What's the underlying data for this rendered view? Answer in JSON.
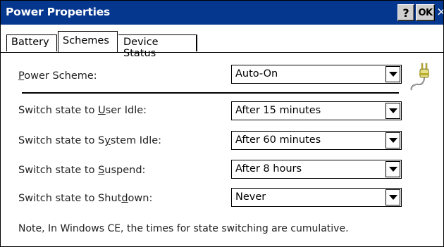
{
  "window": {
    "title": "Power Properties",
    "help_label": "?",
    "ok_label": "OK",
    "close_label": "×",
    "titlebar_color": "#06378f"
  },
  "tabs": [
    {
      "label": "Battery",
      "selected": false
    },
    {
      "label": "Schemes",
      "selected": true
    },
    {
      "label": "Device Status",
      "selected": false
    }
  ],
  "power_scheme": {
    "label_prefix": "",
    "label_mnemonic": "P",
    "label_rest": "ower Scheme:",
    "value": "Auto-On",
    "icon": "power-plug-icon"
  },
  "rows": [
    {
      "label_prefix": "Switch state to ",
      "mnemonic": "U",
      "label_rest": "ser Idle:",
      "value": "After 15 minutes"
    },
    {
      "label_prefix": "Switch state to S",
      "mnemonic": "y",
      "label_rest": "stem Idle:",
      "value": "After 60 minutes"
    },
    {
      "label_prefix": "Switch state to ",
      "mnemonic": "S",
      "label_rest": "uspend:",
      "value": "After 8 hours"
    },
    {
      "label_prefix": "Switch state to Shut",
      "mnemonic": "d",
      "label_rest": "own:",
      "value": "Never"
    }
  ],
  "note": "Note, In Windows CE, the times for state switching are cumulative."
}
